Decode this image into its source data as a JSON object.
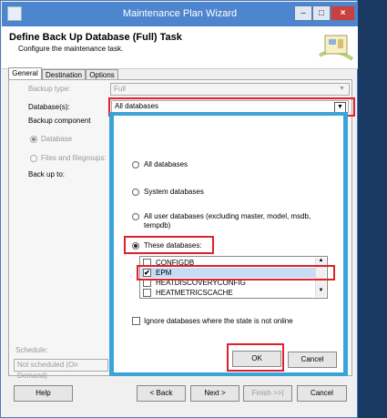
{
  "window": {
    "title": "Maintenance Plan Wizard",
    "minimize": "–",
    "maximize": "□",
    "close": "×"
  },
  "header": {
    "title": "Define Back Up Database (Full) Task",
    "subtitle": "Configure the maintenance task."
  },
  "tabs": [
    "General",
    "Destination",
    "Options"
  ],
  "form": {
    "backup_type_label": "Backup type:",
    "backup_type_value": "Full",
    "databases_label": "Database(s):",
    "databases_value": "All databases",
    "backup_component_label": "Backup component",
    "database_option": "Database",
    "files_option": "Files and filegroups:",
    "backup_to_label": "Back up to:",
    "schedule_label": "Schedule:",
    "schedule_value": "Not scheduled (On Demand)"
  },
  "popup": {
    "all_databases": "All databases",
    "system_databases": "System databases",
    "user_databases_line1": "All user databases  (excluding master, model, msdb,",
    "user_databases_line2": "tempdb)",
    "these_databases": "These databases:",
    "databases": [
      {
        "name": "CONFIGDB",
        "checked": false
      },
      {
        "name": "EPM",
        "checked": true
      },
      {
        "name": "HEATDISCOVERYCONFIG",
        "checked": false
      },
      {
        "name": "HEATMETRICSCACHE",
        "checked": false
      }
    ],
    "ignore_offline": "Ignore databases where the state is not online",
    "ok": "OK",
    "cancel": "Cancel"
  },
  "footer": {
    "help": "Help",
    "back": "< Back",
    "next": "Next >",
    "finish": "Finish >>|",
    "cancel": "Cancel"
  },
  "colors": {
    "highlight_red": "#e0202a",
    "popup_border": "#3aa3d8",
    "titlebar": "#4d86cf"
  }
}
